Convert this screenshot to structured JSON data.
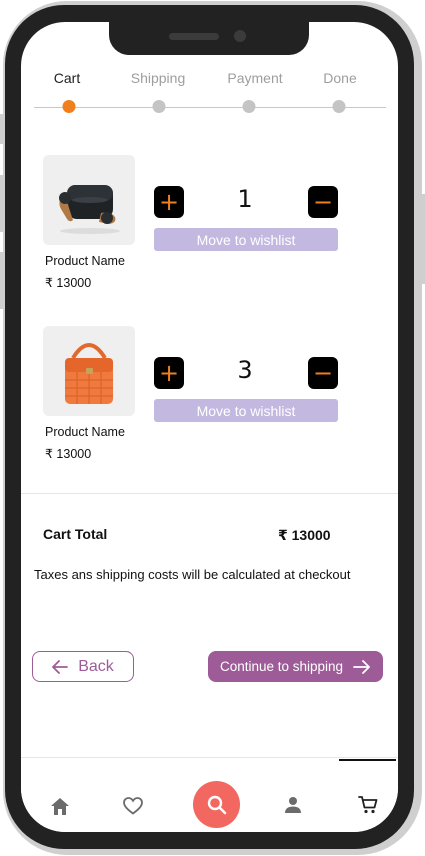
{
  "stepper": {
    "steps": [
      {
        "label": "Cart",
        "active": true
      },
      {
        "label": "Shipping",
        "active": false
      },
      {
        "label": "Payment",
        "active": false
      },
      {
        "label": "Done",
        "active": false
      }
    ]
  },
  "cart": {
    "items": [
      {
        "name": "Product Name",
        "price": "₹ 13000",
        "quantity": "1",
        "plus_icon": "plus-icon",
        "minus_icon": "minus-icon",
        "wishlist_label": "Move to wishlist",
        "image": "earbuds-image"
      },
      {
        "name": "Product Name",
        "price": "₹ 13000",
        "quantity": "3",
        "plus_icon": "plus-icon",
        "minus_icon": "minus-icon",
        "wishlist_label": "Move to wishlist",
        "image": "handbag-image"
      }
    ]
  },
  "summary": {
    "total_label": "Cart Total",
    "total_value": "₹ 13000",
    "note": "Taxes ans shipping costs will be calculated at checkout"
  },
  "actions": {
    "back_label": "Back",
    "continue_label": "Continue to shipping"
  },
  "nav": {
    "items": [
      "home-icon",
      "heart-icon",
      "search-icon",
      "user-icon",
      "cart-icon"
    ],
    "active": "cart-icon"
  },
  "colors": {
    "accent": "#f07f1e",
    "primary": "#9d5c98",
    "wishlist": "#c2b8e0",
    "search": "#f2675f"
  }
}
